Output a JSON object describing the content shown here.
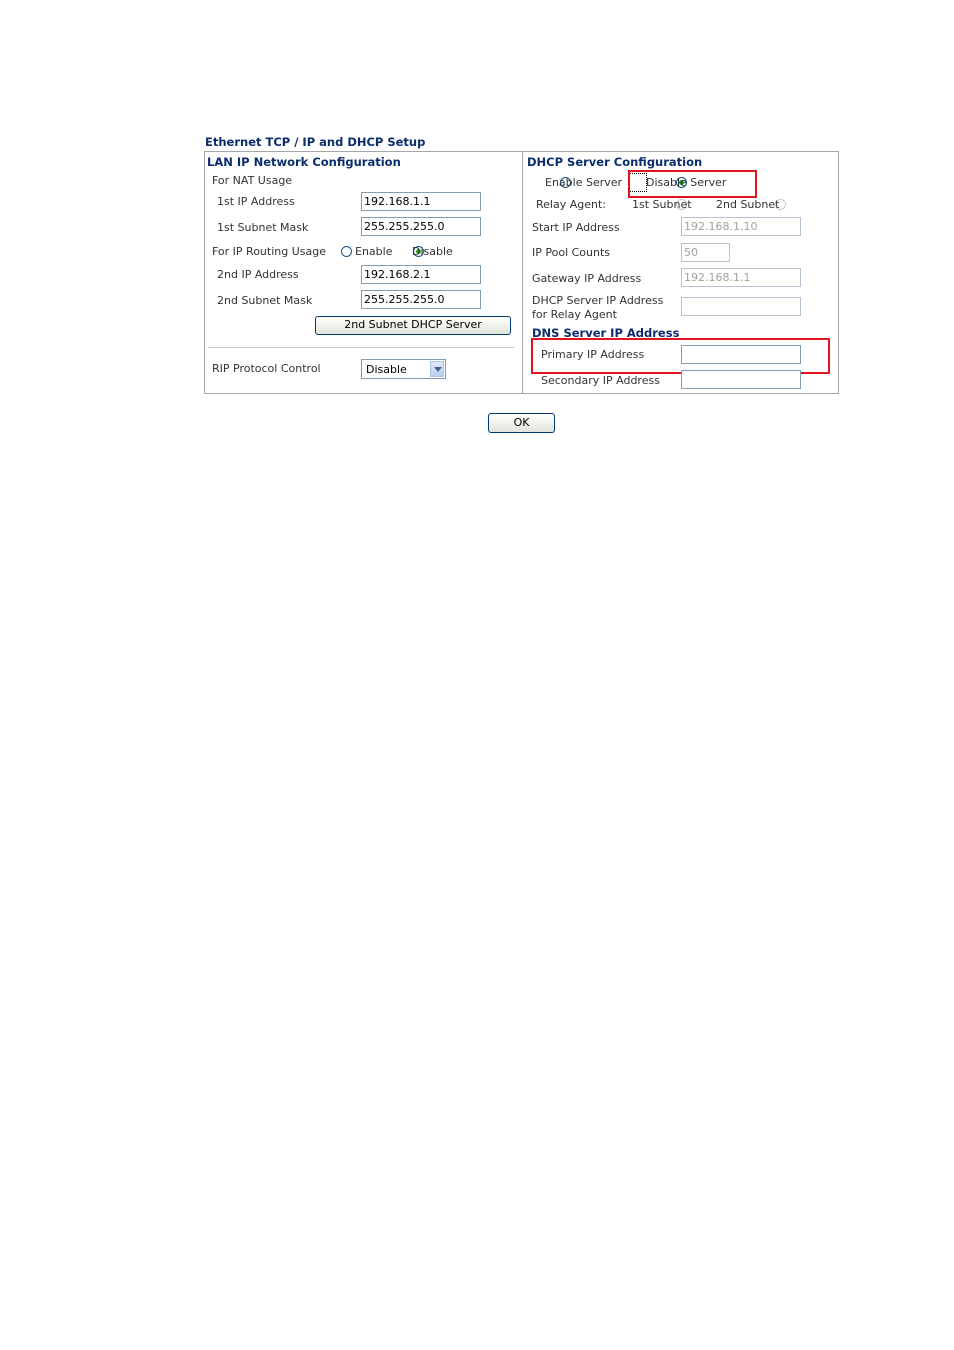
{
  "page": {
    "title": "Ethernet TCP / IP and DHCP Setup"
  },
  "lan": {
    "heading": "LAN IP Network Configuration",
    "nat_label": "For NAT Usage",
    "ip1_label": "1st IP Address",
    "ip1_value": "192.168.1.1",
    "mask1_label": "1st Subnet Mask",
    "mask1_value": "255.255.255.0",
    "routing_label": "For IP Routing Usage",
    "routing_enable": "Enable",
    "routing_disable": "Disable",
    "routing_selected": "Disable",
    "ip2_label": "2nd IP Address",
    "ip2_value": "192.168.2.1",
    "mask2_label": "2nd Subnet Mask",
    "mask2_value": "255.255.255.0",
    "dhcp2_button": "2nd Subnet DHCP Server",
    "rip_label": "RIP Protocol Control",
    "rip_value": "Disable"
  },
  "dhcp": {
    "heading": "DHCP Server Configuration",
    "enable_label": "Enable Server",
    "disable_label": "Disable Server",
    "selected": "Disable Server",
    "relay_label": "Relay Agent:",
    "relay_1st": "1st Subnet",
    "relay_2nd": "2nd Subnet",
    "start_label": "Start IP Address",
    "start_value": "192.168.1.10",
    "pool_label": "IP Pool Counts",
    "pool_value": "50",
    "gateway_label": "Gateway IP Address",
    "gateway_value": "192.168.1.1",
    "relay_server_label_1": "DHCP Server IP Address",
    "relay_server_label_2": "for Relay Agent",
    "relay_server_value": ""
  },
  "dns": {
    "heading": "DNS Server IP Address",
    "primary_label": "Primary IP Address",
    "primary_value": "",
    "secondary_label": "Secondary IP Address",
    "secondary_value": ""
  },
  "actions": {
    "ok_label": "OK"
  },
  "colors": {
    "heading": "#0b2d6b",
    "highlight": "#e0141e",
    "radio_selected": "#21a121"
  }
}
